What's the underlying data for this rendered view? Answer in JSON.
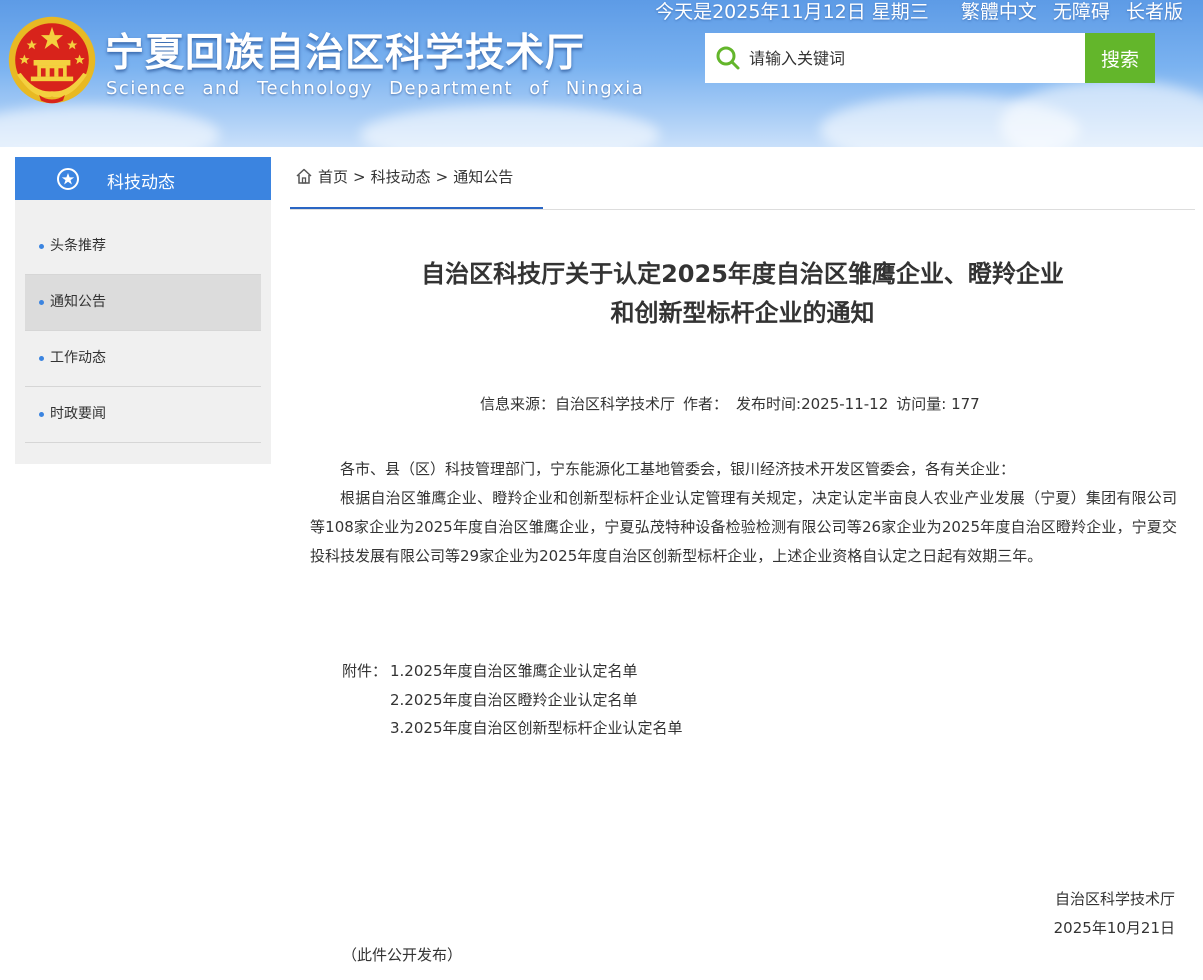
{
  "header": {
    "site_title": "宁夏回族自治区科学技术厅",
    "site_subtitle": "Science and Technology Department of Ningxia",
    "date_text": "今天是2025年11月12日 星期三",
    "links": [
      "繁體中文",
      "无障碍",
      "长者版"
    ],
    "search": {
      "placeholder": "请输入关键词",
      "button_label": "搜索"
    }
  },
  "sidebar": {
    "title": "科技动态",
    "items": [
      {
        "label": "头条推荐"
      },
      {
        "label": "通知公告"
      },
      {
        "label": "工作动态"
      },
      {
        "label": "时政要闻"
      }
    ],
    "active_index": 1
  },
  "breadcrumb": {
    "items": [
      "首页",
      "科技动态",
      "通知公告"
    ],
    "separator": ">"
  },
  "article": {
    "title_line1": "自治区科技厅关于认定2025年度自治区雏鹰企业、瞪羚企业",
    "title_line2": "和创新型标杆企业的通知",
    "meta": {
      "source": "信息来源：自治区科学技术厅",
      "author": "作者：",
      "date": "发布时间:2025-11-12",
      "views": "访问量: 177"
    },
    "paragraphs": [
      "各市、县（区）科技管理部门，宁东能源化工基地管委会，银川经济技术开发区管委会，各有关企业：",
      "根据自治区雏鹰企业、瞪羚企业和创新型标杆企业认定管理有关规定，决定认定半亩良人农业产业发展（宁夏）集团有限公司等108家企业为2025年度自治区雏鹰企业，宁夏弘茂特种设备检验检测有限公司等26家企业为2025年度自治区瞪羚企业，宁夏交投科技发展有限公司等29家企业为2025年度自治区创新型标杆企业，上述企业资格自认定之日起有效期三年。"
    ],
    "attachment_label": "附件：",
    "attachments": [
      "1.2025年度自治区雏鹰企业认定名单",
      "2.2025年度自治区瞪羚企业认定名单",
      "3.2025年度自治区创新型标杆企业认定名单"
    ],
    "signature": {
      "org": "自治区科学技术厅",
      "date": "2025年10月21日"
    },
    "note": "（此件公开发布）"
  },
  "colors": {
    "accent_blue": "#3b84e0",
    "search_green": "#63b62b",
    "breadcrumb_underline": "#2a66c4",
    "sidebar_active": "#dcdcdc"
  }
}
